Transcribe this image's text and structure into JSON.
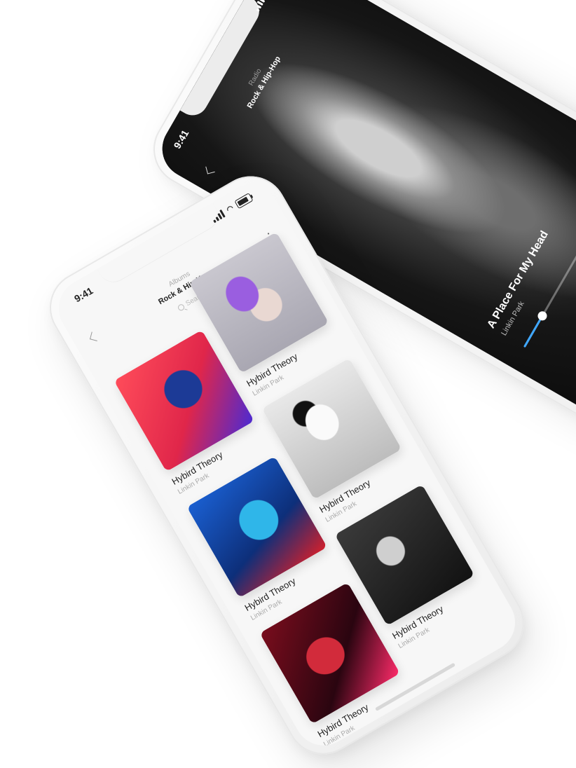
{
  "status": {
    "time": "9:41"
  },
  "albums_screen": {
    "subtitle": "Albums",
    "title": "Rock & Hip-Hop",
    "search_placeholder": "Search",
    "albums": [
      {
        "title": "Hybird Theory",
        "artist": "Linkin Park"
      },
      {
        "title": "Hybird Theory",
        "artist": "Linkin Park"
      },
      {
        "title": "Hybird Theory",
        "artist": "Linkin Park"
      },
      {
        "title": "Hybird Theory",
        "artist": "Linkin Park"
      },
      {
        "title": "Hybird Theory",
        "artist": "Linkin Park"
      },
      {
        "title": "Hybird Theory",
        "artist": "Linkin Park"
      }
    ]
  },
  "player_screen": {
    "subtitle": "Radio",
    "title": "Rock & Hip-Hop",
    "track_title": "A Place For My Head",
    "artist": "Linkin Park",
    "progress": 0.18
  },
  "colors": {
    "accent": "#3fa7ff",
    "dark_bg": "#121212",
    "light_bg": "#f7f7f7"
  }
}
